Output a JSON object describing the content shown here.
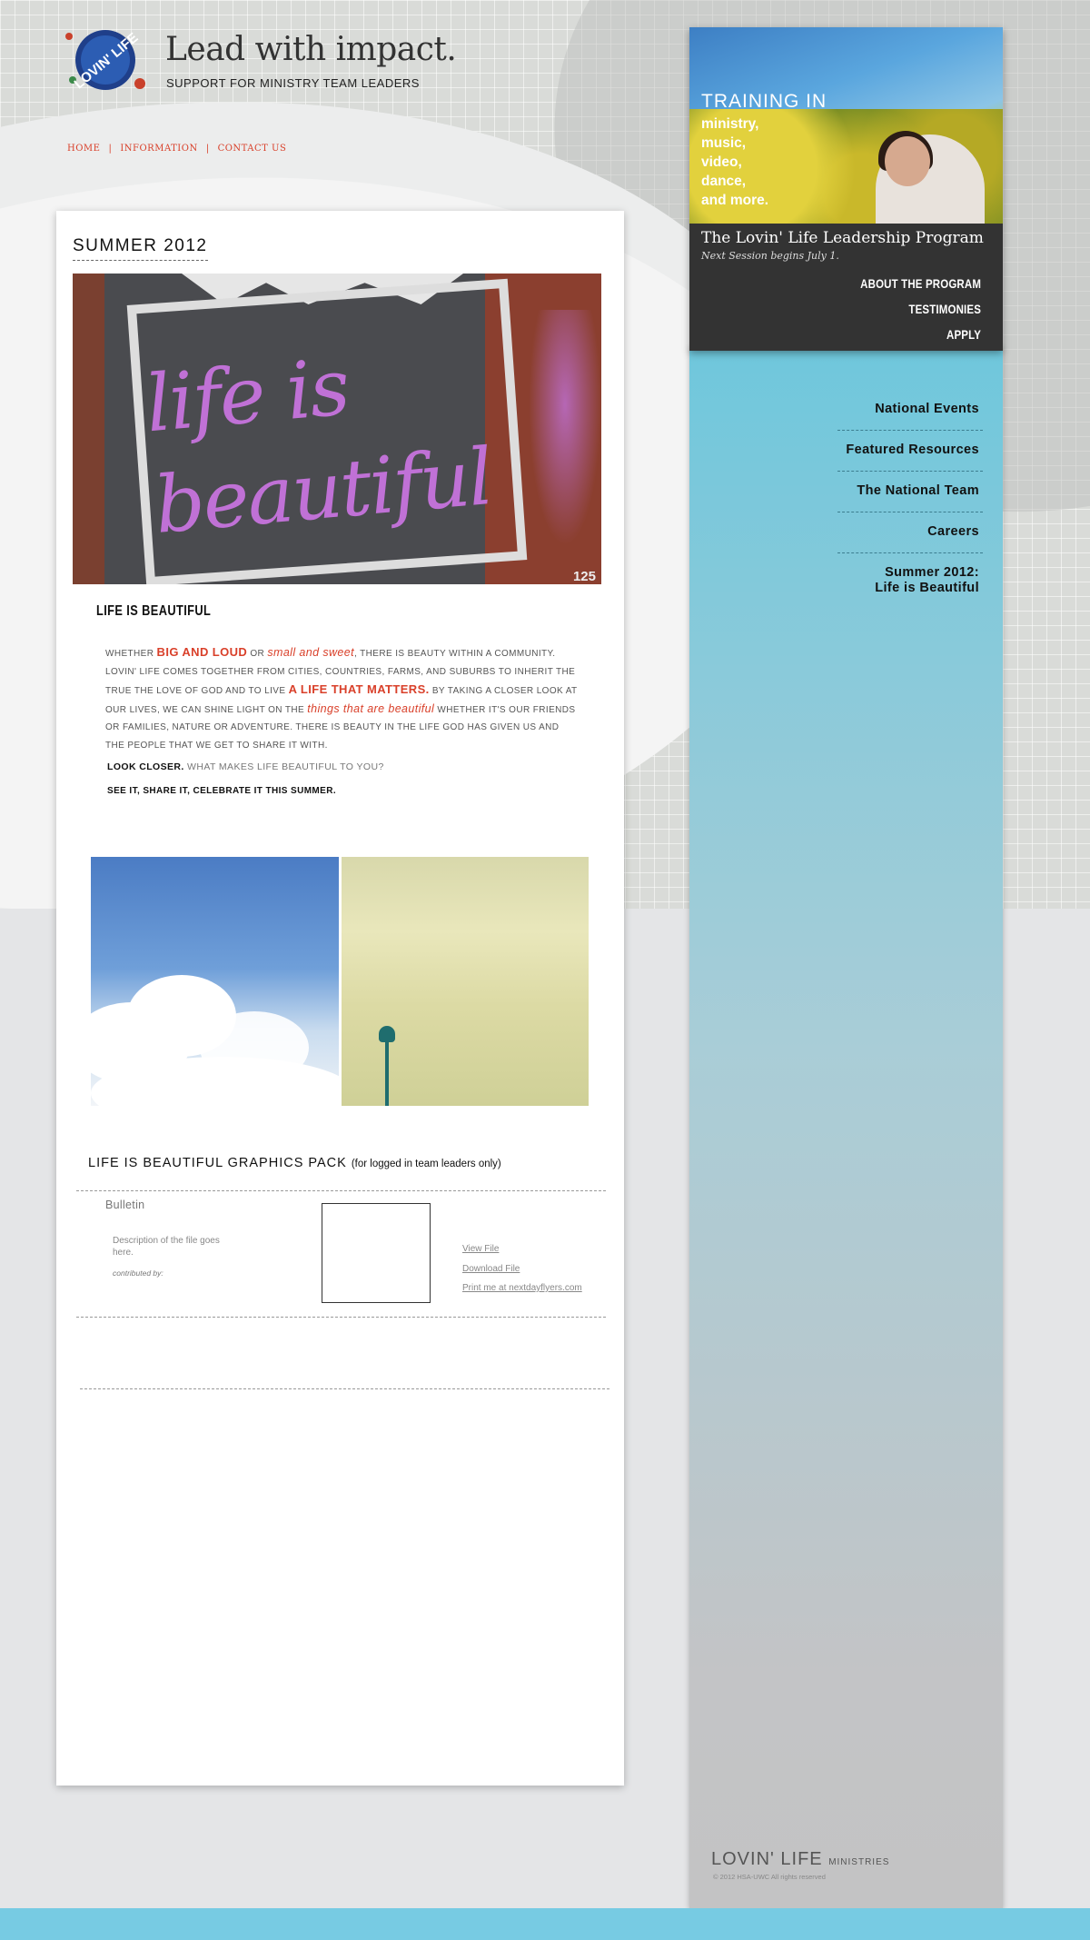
{
  "colors": {
    "accent": "#d9402a",
    "side_blue": "#6fc7dc",
    "promo_dark": "#333333",
    "footer_bar": "#77cbe3"
  },
  "header": {
    "logo_text": "LOVIN' LIFE",
    "headline": "Lead with impact.",
    "tagline": "SUPPORT FOR MINISTRY TEAM LEADERS",
    "nav": [
      "HOME",
      "INFORMATION",
      "CONTACT US"
    ]
  },
  "promo": {
    "training": "TRAINING IN",
    "items": [
      "ministry,",
      "music,",
      "video,",
      "dance,",
      "and more."
    ],
    "program_title": "The Lovin' Life Leadership Program",
    "program_sub": "Next Session begins July 1.",
    "links": [
      "ABOUT THE PROGRAM",
      "TESTIMONIES",
      "APPLY"
    ]
  },
  "sidenav": {
    "items": [
      "National Events",
      "Featured Resources",
      "The National Team",
      "Careers"
    ],
    "current": [
      "Summer 2012:",
      "Life is Beautiful"
    ]
  },
  "main": {
    "season_title": "SUMMER 2012",
    "hero": {
      "writing_1": "life is",
      "writing_2": "beautiful",
      "number": "125"
    },
    "article_title": "LIFE IS BEAUTIFUL",
    "article": {
      "p1": "WHETHER ",
      "big_loud": "BIG AND LOUD",
      "p2": " OR ",
      "small_sweet": "small and sweet",
      "p3": ", THERE IS BEAUTY WITHIN A COMMUNITY. LOVIN' LIFE COMES TOGETHER FROM CITIES, COUNTRIES, FARMS, AND SUBURBS TO INHERIT THE TRUE THE LOVE OF GOD AND TO LIVE ",
      "life_matters": "A LIFE THAT MATTERS.",
      "p4": " BY TAKING A CLOSER LOOK AT OUR LIVES, WE CAN SHINE LIGHT ON THE ",
      "things_beautiful": "things that are beautiful",
      "p5": " WHETHER IT'S OUR FRIENDS OR FAMILIES, NATURE OR ADVENTURE. THERE IS BEAUTY IN THE LIFE GOD HAS GIVEN US AND THE PEOPLE THAT WE GET TO SHARE IT WITH."
    },
    "look_closer_bold": "LOOK CLOSER.",
    "look_closer_rest": " WHAT MAKES LIFE BEAUTIFUL TO YOU?",
    "share_line": "SEE IT, SHARE IT, CELEBRATE IT THIS SUMMER."
  },
  "graphics_pack": {
    "title": "LIFE IS BEAUTIFUL GRAPHICS PACK",
    "note": "(for logged in team leaders only)",
    "file_name": "Bulletin",
    "description": "Description of the file goes here.",
    "contributed": "contributed by:",
    "links": [
      "View File",
      "Download File",
      "Print me at nextdayflyers.com"
    ]
  },
  "footer": {
    "brand": "LOVIN' LIFE",
    "brand_small": "MINISTRIES",
    "copyright": "© 2012 HSA-UWC All rights reserved"
  }
}
